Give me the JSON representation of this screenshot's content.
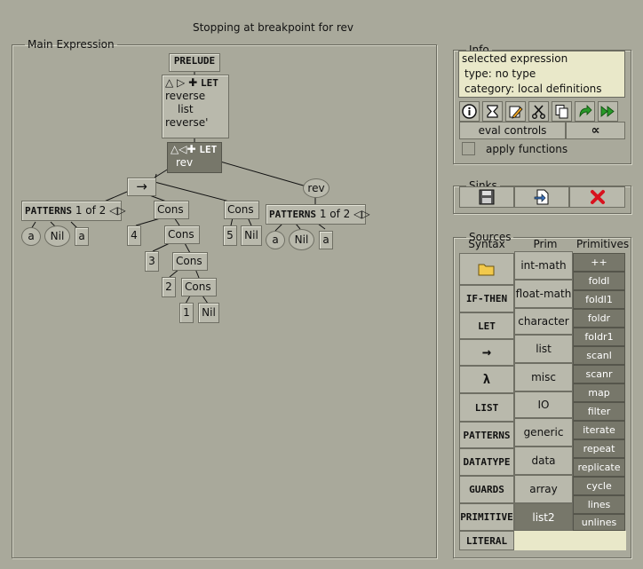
{
  "status": "Stopping at breakpoint for rev",
  "main": {
    "legend": "Main Expression"
  },
  "tree": {
    "prelude": "PRELUDE",
    "let1_keyword": "LET",
    "let1_lines": [
      "reverse",
      "list",
      "reverse'"
    ],
    "let2_keyword": "LET",
    "let2_line": "rev",
    "rev_oval": "rev",
    "arrow": "→",
    "patterns_kw": "PATTERNS",
    "patterns_count": "1 of 2",
    "cons": "Cons",
    "nil": "Nil",
    "var_a": "a",
    "nums": [
      "4",
      "3",
      "2",
      "1",
      "5"
    ]
  },
  "info": {
    "legend": "Info",
    "selected": "selected expression",
    "type": "type: no type",
    "category": "category: local definitions",
    "eval_controls": "eval controls",
    "alpha": "∝",
    "apply_functions": "apply functions",
    "toolbar_icons": [
      "info-icon",
      "hourglass-icon",
      "edit-icon",
      "cut-icon",
      "copy-icon",
      "step-icon",
      "run-icon"
    ]
  },
  "sinks": {
    "legend": "Sinks"
  },
  "sources": {
    "legend": "Sources",
    "headers": {
      "syntax": "Syntax",
      "prim_groups": "Prim Groups",
      "primitives": "Primitives"
    },
    "syntax": [
      "IF-THEN",
      "LET",
      "→",
      "λ",
      "LIST",
      "PATTERNS",
      "DATATYPE",
      "GUARDS",
      "PRIMITIVE",
      "LITERAL"
    ],
    "prim_groups": [
      "int-math",
      "float-math",
      "character",
      "list",
      "misc",
      "IO",
      "generic",
      "data",
      "array",
      "list2"
    ],
    "primitives": [
      "++",
      "foldl",
      "foldl1",
      "foldr",
      "foldr1",
      "scanl",
      "scanr",
      "map",
      "filter",
      "iterate",
      "repeat",
      "replicate",
      "cycle",
      "lines",
      "unlines"
    ]
  }
}
